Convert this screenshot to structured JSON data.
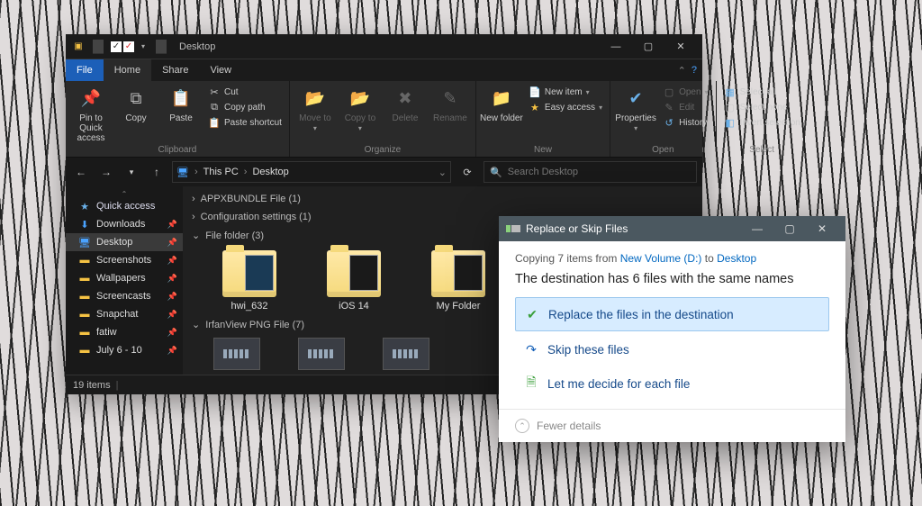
{
  "explorer": {
    "title": "Desktop",
    "tabs": {
      "file": "File",
      "home": "Home",
      "share": "Share",
      "view": "View"
    },
    "ribbon": {
      "clipboard": {
        "label": "Clipboard",
        "pin": "Pin to Quick access",
        "copy": "Copy",
        "paste": "Paste",
        "cut": "Cut",
        "copypath": "Copy path",
        "pasteshortcut": "Paste shortcut"
      },
      "organize": {
        "label": "Organize",
        "moveto": "Move to",
        "copyto": "Copy to",
        "delete": "Delete",
        "rename": "Rename"
      },
      "new": {
        "label": "New",
        "newfolder": "New folder",
        "newitem": "New item",
        "easyaccess": "Easy access"
      },
      "open": {
        "label": "Open",
        "properties": "Properties",
        "open": "Open",
        "edit": "Edit",
        "history": "History"
      },
      "select": {
        "label": "Select",
        "selectall": "Select all",
        "selectnone": "Select none",
        "invert": "Invert selection"
      }
    },
    "breadcrumb": [
      "This PC",
      "Desktop"
    ],
    "search_placeholder": "Search Desktop",
    "tree": {
      "quickaccess": "Quick access",
      "items": [
        {
          "label": "Downloads",
          "icon": "download-icon",
          "color": "#4aa3ff"
        },
        {
          "label": "Desktop",
          "icon": "desktop-icon",
          "color": "#4aa3ff",
          "selected": true
        },
        {
          "label": "Screenshots",
          "icon": "folder-icon",
          "color": "#f5c243"
        },
        {
          "label": "Wallpapers",
          "icon": "folder-icon",
          "color": "#f5c243"
        },
        {
          "label": "Screencasts",
          "icon": "folder-icon",
          "color": "#f5c243"
        },
        {
          "label": "Snapchat",
          "icon": "folder-icon",
          "color": "#f5c243"
        },
        {
          "label": "fatiw",
          "icon": "folder-icon",
          "color": "#f5c243"
        },
        {
          "label": "July 6 - 10",
          "icon": "folder-icon",
          "color": "#f5c243"
        }
      ]
    },
    "groups": [
      {
        "label": "APPXBUNDLE File (1)",
        "expanded": false
      },
      {
        "label": "Configuration settings (1)",
        "expanded": false
      },
      {
        "label": "File folder (3)",
        "expanded": true,
        "tiles": [
          "hwi_632",
          "iOS 14",
          "My Folder"
        ]
      },
      {
        "label": "IrfanView PNG File (7)",
        "expanded": true
      }
    ],
    "statusbar": {
      "count": "19 items"
    }
  },
  "dialog": {
    "title": "Replace or Skip Files",
    "copying_prefix": "Copying 7 items from ",
    "source": "New Volume (D:)",
    "mid": " to ",
    "dest": "Desktop",
    "heading": "The destination has 6 files with the same names",
    "options": [
      {
        "icon": "check-icon",
        "label": "Replace the files in the destination",
        "selected": true
      },
      {
        "icon": "skip-icon",
        "label": "Skip these files",
        "selected": false
      },
      {
        "icon": "decide-icon",
        "label": "Let me decide for each file",
        "selected": false
      }
    ],
    "footer": "Fewer details"
  }
}
